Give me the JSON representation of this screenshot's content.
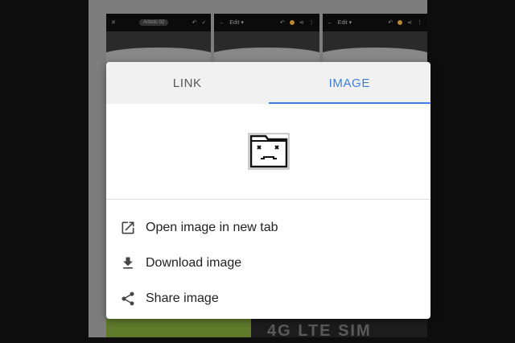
{
  "background": {
    "thumbnails": [
      {
        "chip": "Artistic 02",
        "icons": [
          "close-icon",
          "undo-icon",
          "check-icon"
        ]
      },
      {
        "title": "Edit ▾",
        "icons": [
          "back-icon",
          "undo-icon",
          "look-icon",
          "share-icon",
          "more-icon"
        ]
      },
      {
        "title": "Edit ▾",
        "icons": [
          "back-icon",
          "undo-icon",
          "look-icon",
          "share-icon",
          "more-icon"
        ]
      }
    ],
    "banner_text": "4G LTE SIM"
  },
  "dialog": {
    "tabs": [
      {
        "label": "LINK",
        "active": false
      },
      {
        "label": "IMAGE",
        "active": true
      }
    ],
    "preview_icon": "broken-image-icon",
    "menu": [
      {
        "label": "Open image in new tab",
        "icon": "open-in-new-icon"
      },
      {
        "label": "Download image",
        "icon": "download-icon"
      },
      {
        "label": "Share image",
        "icon": "share-icon"
      }
    ]
  },
  "colors": {
    "accent": "#3d7fe0",
    "tab_bar": "#f1f1f1",
    "scrim": "#7d7d7d"
  }
}
